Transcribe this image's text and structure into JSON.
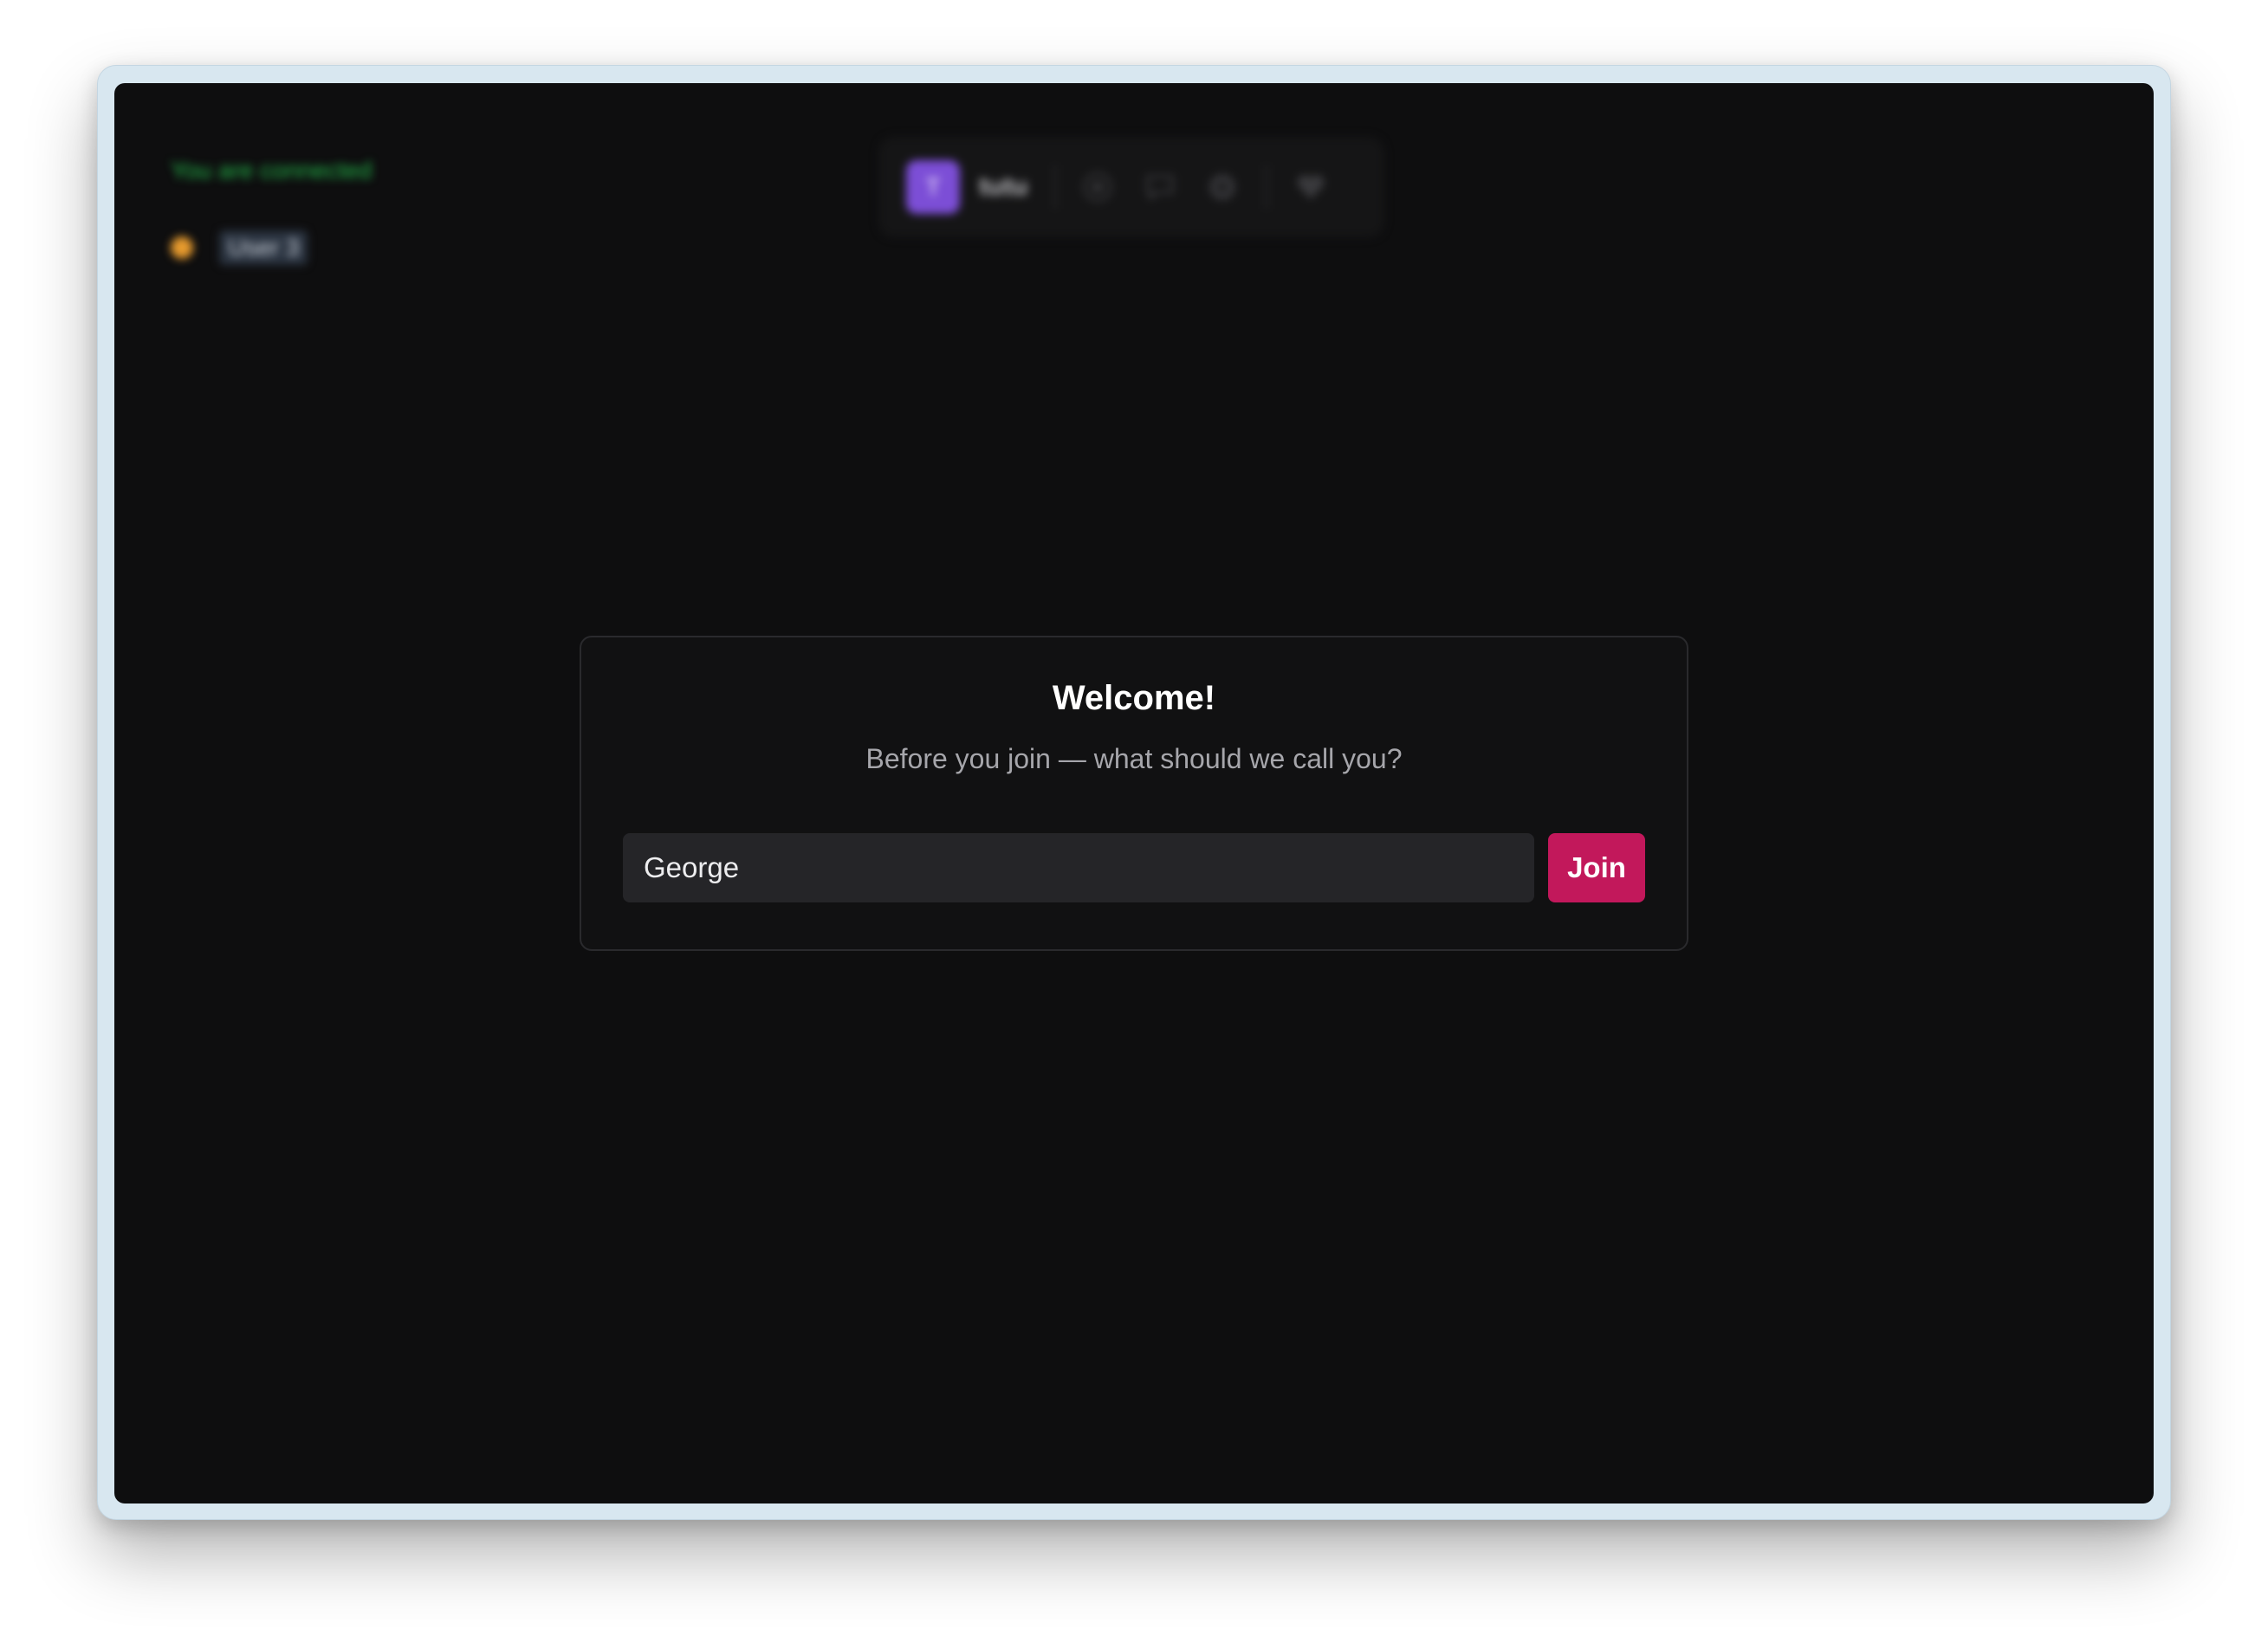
{
  "background": {
    "connection_status": "You are connected",
    "presence": {
      "user_label": "User 3",
      "dot_color": "#e79b2e"
    },
    "toolbar": {
      "avatar_initial": "T",
      "name": "tutu",
      "icons": [
        "sun-icon",
        "chat-icon",
        "settings-icon",
        "heart-icon"
      ]
    }
  },
  "modal": {
    "title": "Welcome!",
    "subtitle": "Before you join — what should we call you?",
    "name_input": {
      "value": "George"
    },
    "join_label": "Join"
  },
  "colors": {
    "app_background": "#0e0e0f",
    "accent": "#c2185b",
    "status_green": "#23b94a",
    "avatar_purple": "#7c4ed6"
  }
}
